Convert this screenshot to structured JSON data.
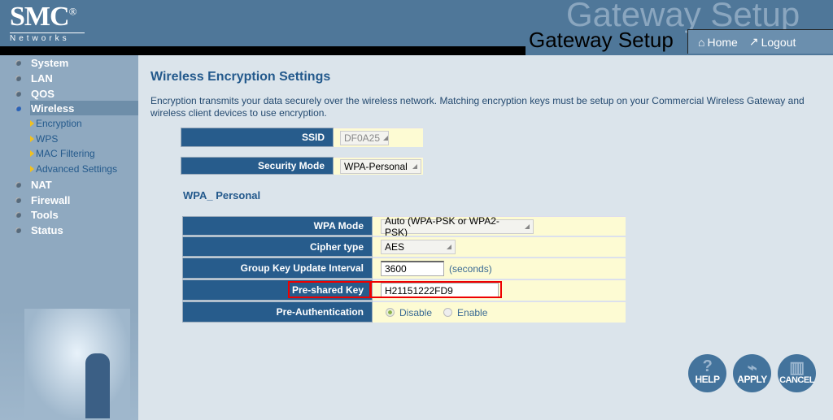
{
  "header": {
    "logo": "SMC",
    "logo_sub": "Networks",
    "ghost_title": "Gateway Setup",
    "title": "Gateway Setup",
    "home": "Home",
    "logout": "Logout"
  },
  "sidebar": {
    "items": [
      {
        "label": "System"
      },
      {
        "label": "LAN"
      },
      {
        "label": "QOS"
      },
      {
        "label": "Wireless",
        "selected": true
      },
      {
        "label": "NAT"
      },
      {
        "label": "Firewall"
      },
      {
        "label": "Tools"
      },
      {
        "label": "Status"
      }
    ],
    "wireless_sub": [
      {
        "label": "Encryption",
        "selected": true
      },
      {
        "label": "WPS"
      },
      {
        "label": "MAC Filtering"
      },
      {
        "label": "Advanced Settings"
      }
    ]
  },
  "main": {
    "title": "Wireless Encryption Settings",
    "description": "Encryption transmits your data securely over the wireless network. Matching encryption keys must be setup on your Commercial Wireless Gateway and wireless client devices to use encryption.",
    "ssid_label": "SSID",
    "ssid_value": "DF0A25",
    "security_mode_label": "Security Mode",
    "security_mode_value": "WPA-Personal",
    "section": "WPA_ Personal",
    "wpa_mode_label": "WPA Mode",
    "wpa_mode_value": "Auto (WPA-PSK or WPA2-PSK)",
    "cipher_label": "Cipher type",
    "cipher_value": "AES",
    "gkui_label": "Group Key Update Interval",
    "gkui_value": "3600",
    "gkui_unit": "(seconds)",
    "psk_label": "Pre-shared Key",
    "psk_value": "H21151222FD9",
    "preauth_label": "Pre-Authentication",
    "preauth_disable": "Disable",
    "preauth_enable": "Enable",
    "preauth_selected": "Disable"
  },
  "buttons": {
    "help": "HELP",
    "apply": "APPLY",
    "cancel": "CANCEL"
  },
  "colors": {
    "header": "#4f7799",
    "label_bg": "#275c8c",
    "value_bg": "#fdfbd3",
    "highlight": "#e00000"
  }
}
